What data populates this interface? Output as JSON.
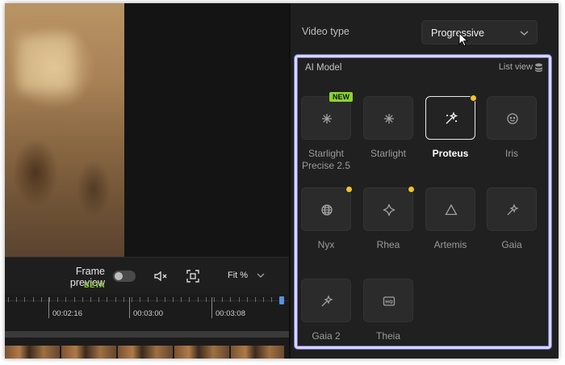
{
  "preview": {
    "frame_preview_label": "Frame preview",
    "beta_badge": "BETA",
    "frame_preview_enabled": false,
    "fit_label": "Fit %",
    "icons": [
      "mute-icon",
      "fit-frame-icon",
      "chevron-down-icon"
    ]
  },
  "timeline": {
    "time_labels": [
      "00:02:16",
      "00:03:00",
      "00:03:08"
    ]
  },
  "panel": {
    "video_type_label": "Video type",
    "video_type_value": "Progressive",
    "ai_model_title": "AI Model",
    "list_view_label": "List view",
    "models": [
      {
        "name": "Starlight Precise 2.5",
        "badge": "NEW",
        "icon": "starburst-icon",
        "selected": false
      },
      {
        "name": "Starlight",
        "icon": "starburst-icon",
        "selected": false
      },
      {
        "name": "Proteus",
        "icon": "magic-wand-icon",
        "selected": true,
        "dot": true
      },
      {
        "name": "Iris",
        "icon": "face-icon",
        "selected": false
      },
      {
        "name": "Nyx",
        "icon": "globe-icon",
        "selected": false,
        "dot": true
      },
      {
        "name": "Rhea",
        "icon": "sparkle-icon",
        "selected": false,
        "dot": true
      },
      {
        "name": "Artemis",
        "icon": "triangle-icon",
        "selected": false
      },
      {
        "name": "Gaia",
        "icon": "wand-icon",
        "selected": false
      },
      {
        "name": "Gaia 2",
        "icon": "wand-icon",
        "selected": false
      },
      {
        "name": "Theia",
        "icon": "hq-icon",
        "selected": false
      }
    ]
  },
  "colors": {
    "accent_green": "#8bd52f",
    "highlight_border": "#d8d8ff",
    "dot_yellow": "#f2c12e"
  }
}
